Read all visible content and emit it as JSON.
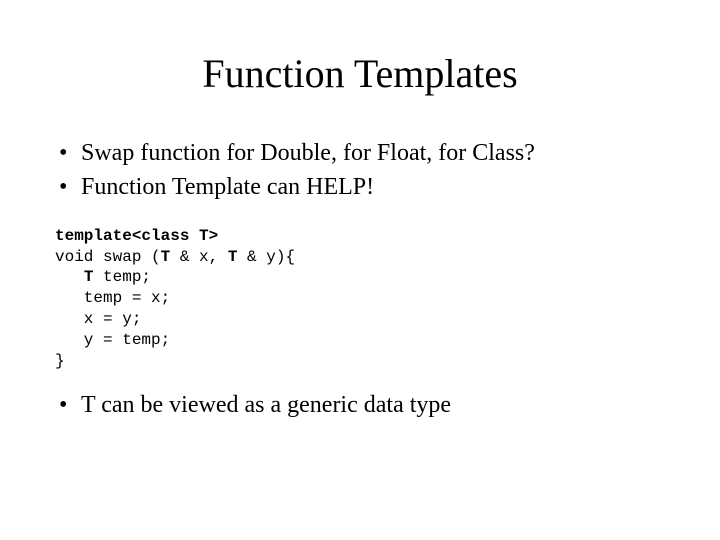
{
  "title": "Function Templates",
  "bullets1": [
    "Swap function for Double, for Float, for Class?",
    "Function Template can HELP!"
  ],
  "code": {
    "l1a": "template<class T>",
    "l2a": "void swap (",
    "l2b": "T",
    "l2c": " & x, ",
    "l2d": "T",
    "l2e": " & y){",
    "l3a": "   ",
    "l3b": "T",
    "l3c": " temp;",
    "l4": "   temp = x;",
    "l5": "   x = y;",
    "l6": "   y = temp;",
    "l7": "}"
  },
  "bullets2": [
    "T can be viewed as a generic data type"
  ]
}
